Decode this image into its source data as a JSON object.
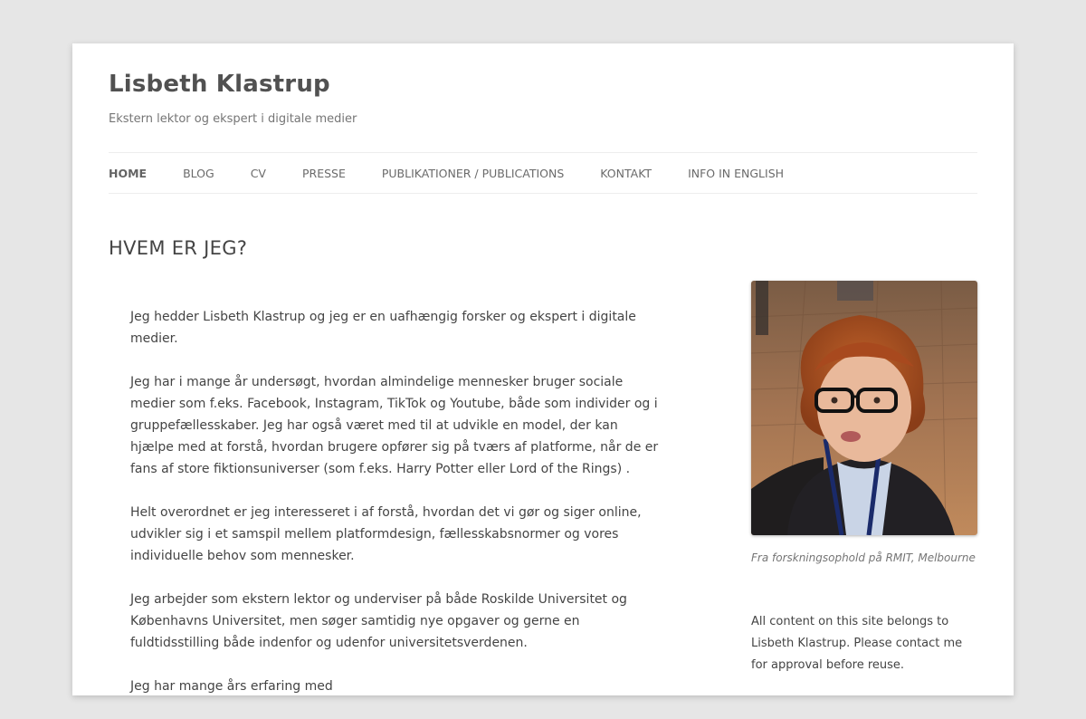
{
  "header": {
    "site_title": "Lisbeth Klastrup",
    "tagline": "Ekstern lektor og ekspert i digitale medier"
  },
  "nav": {
    "items": [
      {
        "label": "HOME"
      },
      {
        "label": "BLOG"
      },
      {
        "label": "CV"
      },
      {
        "label": "PRESSE"
      },
      {
        "label": "PUBLIKATIONER / PUBLICATIONS"
      },
      {
        "label": "KONTAKT"
      },
      {
        "label": "INFO IN ENGLISH"
      }
    ]
  },
  "page": {
    "title": "HVEM ER JEG?",
    "paragraphs": [
      "Jeg hedder Lisbeth Klastrup og jeg er en uafhængig forsker og ekspert i digitale medier.",
      "Jeg har i mange år undersøgt, hvordan almindelige mennesker bruger sociale medier som f.eks. Facebook, Instagram, TikTok og Youtube, både som individer og i gruppefællesskaber. Jeg har også været med til at udvikle en model, der kan hjælpe med at forstå, hvordan brugere opfører sig på tværs af platforme, når de er fans af store fik­tionsuniverser (som f.eks. Harry Potter eller Lord of the Rings) .",
      "Helt overordnet er jeg interesseret i af forstå, hvordan det vi gør og siger online, udvikler sig i et samspil mellem platformdesign, fællesskabsnormer og vores individuelle behov som mennesker.",
      "Jeg arbejder som ekstern lektor og underviser på både Roskilde Universitet og Københavns Universitet, men søger samtidig nye opgaver og gerne en fuldtidsstilling både indenfor og udenfor universitetsverdenen.",
      "Jeg har mange års erfaring med"
    ]
  },
  "sidebar": {
    "photo_caption": "Fra forskningsophold på RMIT, Melbourne",
    "notice": "All content on this site belongs to Lisbeth Klastrup. Please contact me for approval before reuse."
  }
}
